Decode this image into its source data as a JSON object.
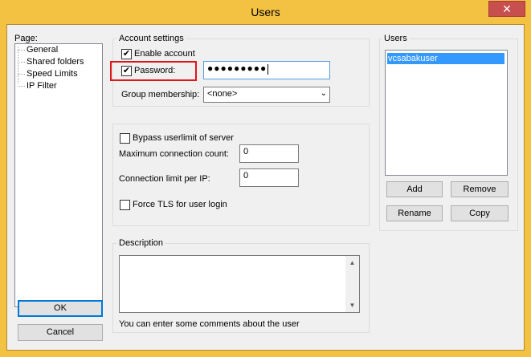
{
  "window": {
    "title": "Users",
    "close_glyph": "✕",
    "colors": {
      "frame": "#f4c242",
      "close": "#c7504f",
      "selection": "#3399ff",
      "highlight": "#e0161a"
    }
  },
  "page_panel": {
    "label": "Page:",
    "items": [
      "General",
      "Shared folders",
      "Speed Limits",
      "IP Filter"
    ]
  },
  "account": {
    "group_label": "Account settings",
    "enable_account_label": "Enable account",
    "enable_account_checked": true,
    "password_label": "Password:",
    "password_checked": true,
    "password_value": "●●●●●●●●●",
    "group_membership_label": "Group membership:",
    "group_membership_value": "<none>"
  },
  "limits": {
    "bypass_label": "Bypass userlimit of server",
    "bypass_checked": false,
    "max_conn_label": "Maximum connection count:",
    "max_conn_value": "0",
    "per_ip_label": "Connection limit per IP:",
    "per_ip_value": "0",
    "force_tls_label": "Force TLS for user login",
    "force_tls_checked": false
  },
  "description": {
    "group_label": "Description",
    "text": "",
    "hint": "You can enter some comments about the user"
  },
  "users": {
    "group_label": "Users",
    "list": [
      "vcsabakuser"
    ],
    "selected_index": 0,
    "add_label": "Add",
    "remove_label": "Remove",
    "rename_label": "Rename",
    "copy_label": "Copy"
  },
  "buttons": {
    "ok_label": "OK",
    "cancel_label": "Cancel"
  },
  "icons": {
    "check": "✔",
    "dropdown": "⌄",
    "up_arrow": "▲",
    "down_arrow": "▼"
  }
}
